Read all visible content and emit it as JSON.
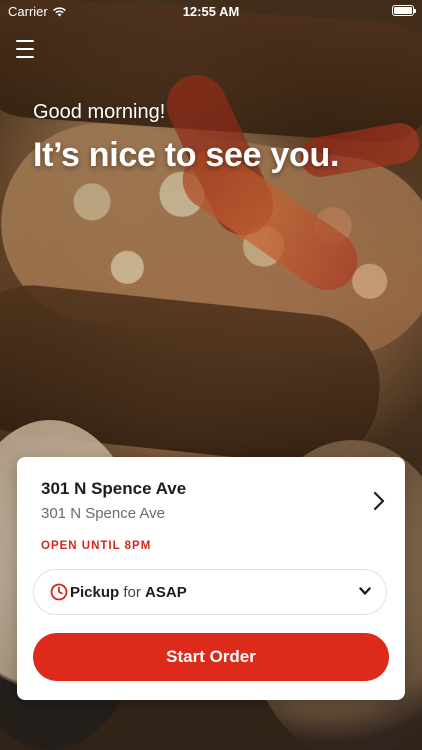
{
  "status_bar": {
    "carrier": "Carrier",
    "time": "12:55 AM",
    "wifi_icon": "wifi-icon",
    "battery_icon": "battery-icon",
    "battery_level": 1.0
  },
  "header": {
    "menu_icon": "hamburger-menu-icon"
  },
  "hero": {
    "greeting": "Good morning!",
    "headline": "It’s nice to see you."
  },
  "location_card": {
    "store_name": "301 N Spence Ave",
    "store_address": "301 N Spence Ave",
    "hours_status": "OPEN UNTIL 8PM",
    "order_type": {
      "mode": "Pickup",
      "connector": "for",
      "time": "ASAP"
    },
    "start_button_label": "Start Order"
  },
  "colors": {
    "accent": "#de2a1b",
    "hours_text": "#d7261c",
    "card_background": "#ffffff"
  }
}
